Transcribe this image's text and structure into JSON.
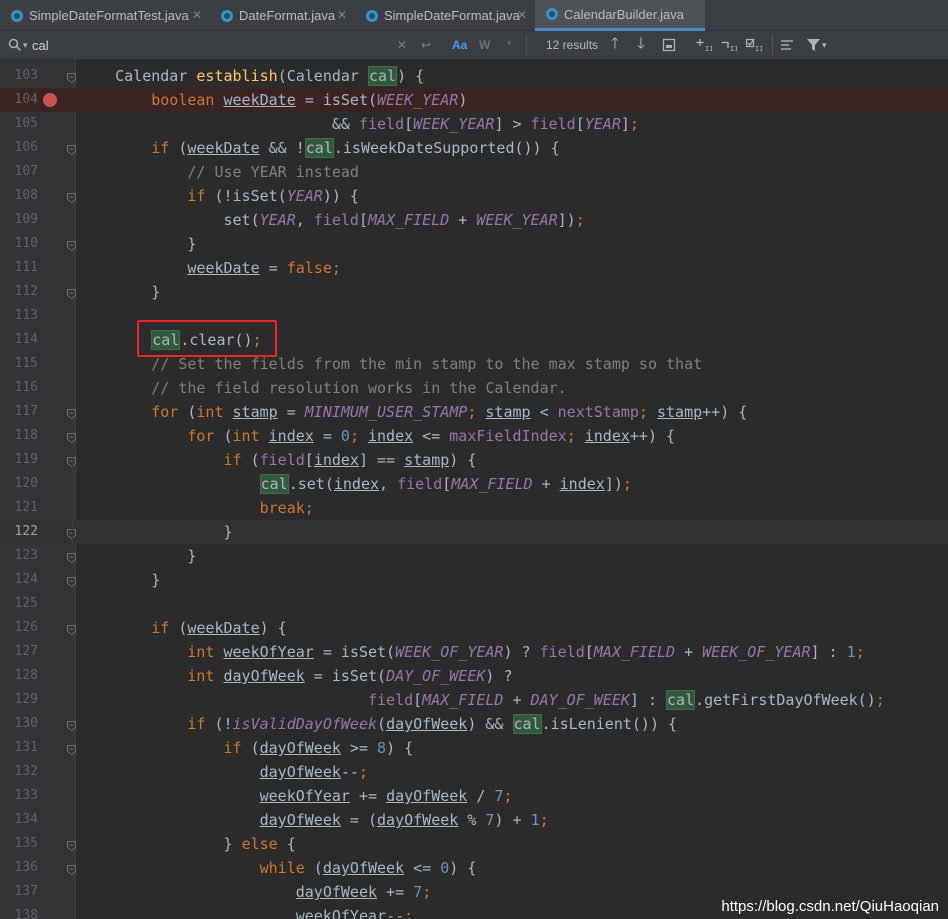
{
  "tabs": [
    {
      "label": "SimpleDateFormatTest.java",
      "active": false
    },
    {
      "label": "DateFormat.java",
      "active": false
    },
    {
      "label": "SimpleDateFormat.java",
      "active": false
    },
    {
      "label": "CalendarBuilder.java",
      "active": true
    }
  ],
  "search": {
    "query": "cal",
    "results": "12 results",
    "match_case": "Aa",
    "words": "W",
    "regex": "*"
  },
  "code_lines": [
    {
      "n": 103,
      "t": "    <span class=\"t\">Calendar</span> <span class=\"fn\">establish</span>(Calendar <span class=\"m\">cal</span>) {"
    },
    {
      "n": 104,
      "t": "        <span class=\"kw\">boolean</span> <span class=\"lv\">weekDate</span> = isSet(<span class=\"st\">WEEK_YEAR</span>)"
    },
    {
      "n": 105,
      "t": "                            &amp;&amp; <span class=\"fd\">field</span>[<span class=\"st\">WEEK_YEAR</span>] &gt; <span class=\"fd\">field</span>[<span class=\"st\">YEAR</span>]<span class=\"kw\">;</span>"
    },
    {
      "n": 106,
      "t": "        <span class=\"kw\">if</span> (<span class=\"lv\">weekDate</span> &amp;&amp; !<span class=\"m\">cal</span>.isWeekDateSupported()) {"
    },
    {
      "n": 107,
      "t": "            <span class=\"cm\">// Use YEAR instead</span>"
    },
    {
      "n": 108,
      "t": "            <span class=\"kw\">if</span> (!isSet(<span class=\"st\">YEAR</span>)) {"
    },
    {
      "n": 109,
      "t": "                set(<span class=\"st\">YEAR</span>, <span class=\"fd\">field</span>[<span class=\"st\">MAX_FIELD</span> + <span class=\"st\">WEEK_YEAR</span>])<span class=\"kw\">;</span>"
    },
    {
      "n": 110,
      "t": "            }"
    },
    {
      "n": 111,
      "t": "            <span class=\"lv\">weekDate</span> = <span class=\"kw\">false;</span>"
    },
    {
      "n": 112,
      "t": "        }"
    },
    {
      "n": 113,
      "t": ""
    },
    {
      "n": 114,
      "t": "        <span class=\"m\">cal</span>.clear()<span class=\"kw\">;</span>"
    },
    {
      "n": 115,
      "t": "        <span class=\"cm\">// Set the fields from the min stamp to the max stamp so that</span>"
    },
    {
      "n": 116,
      "t": "        <span class=\"cm\">// the field resolution works in the Calendar.</span>"
    },
    {
      "n": 117,
      "t": "        <span class=\"kw\">for</span> (<span class=\"kw\">int</span> <span class=\"lv\">stamp</span> = <span class=\"st\">MINIMUM_USER_STAMP</span><span class=\"kw\">;</span> <span class=\"lv\">stamp</span> &lt; <span class=\"fd\">nextStamp</span><span class=\"kw\">;</span> <span class=\"lv\">stamp</span>++) {"
    },
    {
      "n": 118,
      "t": "            <span class=\"kw\">for</span> (<span class=\"kw\">int</span> <span class=\"lv\">index</span> = <span class=\"nm\">0</span><span class=\"kw\">;</span> <span class=\"lv\">index</span> &lt;= <span class=\"fd\">maxFieldIndex</span><span class=\"kw\">;</span> <span class=\"lv\">index</span>++) {"
    },
    {
      "n": 119,
      "t": "                <span class=\"kw\">if</span> (<span class=\"fd\">field</span>[<span class=\"lv\">index</span>] == <span class=\"lv\">stamp</span>) {"
    },
    {
      "n": 120,
      "t": "                    <span class=\"m\">cal</span>.set(<span class=\"lv\">index</span>, <span class=\"fd\">field</span>[<span class=\"st\">MAX_FIELD</span> + <span class=\"lv\">index</span>])<span class=\"kw\">;</span>"
    },
    {
      "n": 121,
      "t": "                    <span class=\"kw\">break;</span>"
    },
    {
      "n": 122,
      "t": "                }"
    },
    {
      "n": 123,
      "t": "            }"
    },
    {
      "n": 124,
      "t": "        }"
    },
    {
      "n": 125,
      "t": ""
    },
    {
      "n": 126,
      "t": "        <span class=\"kw\">if</span> (<span class=\"lv\">weekDate</span>) {"
    },
    {
      "n": 127,
      "t": "            <span class=\"kw\">int</span> <span class=\"lv\">weekOfYear</span> = isSet(<span class=\"st\">WEEK_OF_YEAR</span>) ? <span class=\"fd\">field</span>[<span class=\"st\">MAX_FIELD</span> + <span class=\"st\">WEEK_OF_YEAR</span>] : <span class=\"nm\">1</span><span class=\"kw\">;</span>"
    },
    {
      "n": 128,
      "t": "            <span class=\"kw\">int</span> <span class=\"lv\">dayOfWeek</span> = isSet(<span class=\"st\">DAY_OF_WEEK</span>) ?"
    },
    {
      "n": 129,
      "t": "                                <span class=\"fd\">field</span>[<span class=\"st\">MAX_FIELD</span> + <span class=\"st\">DAY_OF_WEEK</span>] : <span class=\"m\">cal</span>.getFirstDayOfWeek()<span class=\"kw\">;</span>"
    },
    {
      "n": 130,
      "t": "            <span class=\"kw\">if</span> (!<span class=\"st\">isValidDayOfWeek</span>(<span class=\"lv\">dayOfWeek</span>) &amp;&amp; <span class=\"m\">cal</span>.isLenient()) {"
    },
    {
      "n": 131,
      "t": "                <span class=\"kw\">if</span> (<span class=\"lv\">dayOfWeek</span> &gt;= <span class=\"nm\">8</span>) {"
    },
    {
      "n": 132,
      "t": "                    <span class=\"lv\">dayOfWeek</span>--<span class=\"kw\">;</span>"
    },
    {
      "n": 133,
      "t": "                    <span class=\"lv\">weekOfYear</span> += <span class=\"lv\">dayOfWeek</span> / <span class=\"nm\">7</span><span class=\"kw\">;</span>"
    },
    {
      "n": 134,
      "t": "                    <span class=\"lv\">dayOfWeek</span> = (<span class=\"lv\">dayOfWeek</span> % <span class=\"nm\">7</span>) + <span class=\"nm\">1</span><span class=\"kw\">;</span>"
    },
    {
      "n": 135,
      "t": "                } <span class=\"kw\">else</span> {"
    },
    {
      "n": 136,
      "t": "                    <span class=\"kw\">while</span> (<span class=\"lv\">dayOfWeek</span> &lt;= <span class=\"nm\">0</span>) {"
    },
    {
      "n": 137,
      "t": "                        <span class=\"lv\">dayOfWeek</span> += <span class=\"nm\">7</span><span class=\"kw\">;</span>"
    },
    {
      "n": 138,
      "t": "                        <span class=\"lv\">weekOfYear</span>--<span class=\"kw\">;</span>"
    }
  ],
  "breakpoint_line": 104,
  "current_line": 122,
  "watermark": "https://blog.csdn.net/QiuHaoqian",
  "colors": {
    "keyword": "#cc7832",
    "method": "#ffc66d",
    "field": "#9876aa",
    "comment": "#808080",
    "number": "#6897bb",
    "match": "#32593d",
    "breakpoint": "#c75450"
  }
}
